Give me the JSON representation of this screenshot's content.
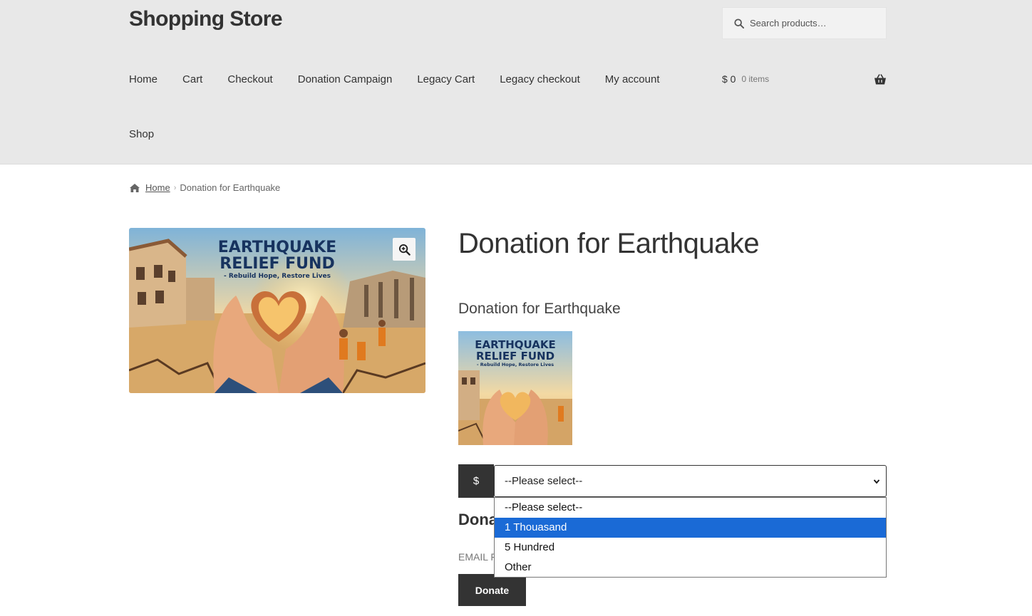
{
  "header": {
    "site_title": "Shopping Store",
    "search_placeholder": "Search products…",
    "nav": [
      "Home",
      "Cart",
      "Checkout",
      "Donation Campaign",
      "Legacy Cart",
      "Legacy checkout",
      "My account"
    ],
    "nav_shop": "Shop",
    "cart": {
      "amount": "$ 0",
      "count": "0 items"
    }
  },
  "breadcrumb": {
    "home": "Home",
    "current": "Donation for Earthquake"
  },
  "product": {
    "title": "Donation for Earthquake",
    "subtitle": "Donation for Earthquake",
    "image_text": {
      "line1": "EARTHQUAKE",
      "line2": "RELIEF FUND",
      "line3": "- Rebuild Hope, Restore Lives"
    }
  },
  "form": {
    "currency": "$",
    "selected": "--Please select--",
    "options": [
      "--Please select--",
      "1 Thouasand",
      "5 Hundred",
      "Other"
    ],
    "highlighted_index": 1,
    "section_heading": "Dona",
    "email_label": "EMAIL F",
    "donate_label": "Donate"
  }
}
